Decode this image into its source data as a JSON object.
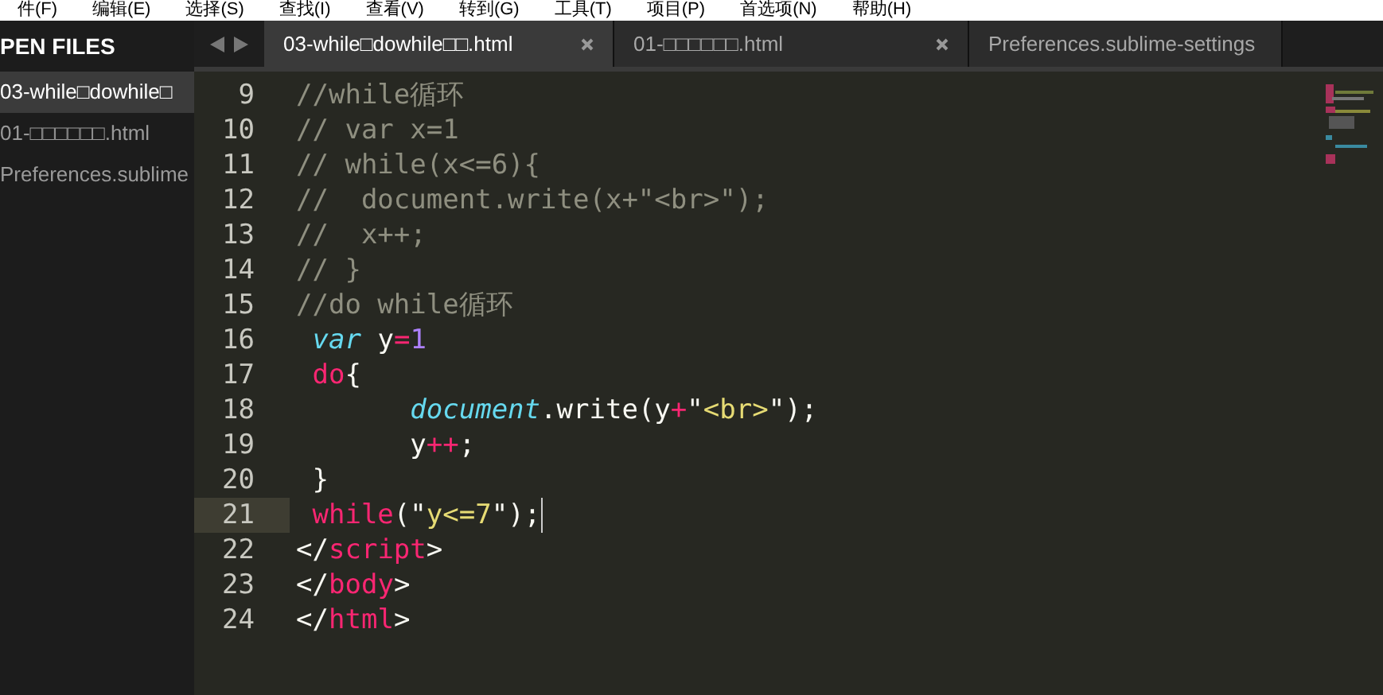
{
  "menu_bar": [
    "件(F)",
    "编辑(E)",
    "选择(S)",
    "查找(I)",
    "查看(V)",
    "转到(G)",
    "工具(T)",
    "项目(P)",
    "首选项(N)",
    "帮助(H)"
  ],
  "sidebar": {
    "title": "PEN FILES",
    "items": [
      {
        "label": "03-while□dowhile□",
        "selected": true
      },
      {
        "label": "01-□□□□□□.html",
        "selected": false
      },
      {
        "label": "Preferences.sublime",
        "selected": false
      }
    ]
  },
  "tabs": [
    {
      "label": "03-while□dowhile□□.html",
      "selected": true
    },
    {
      "label": "01-□□□□□□.html",
      "selected": false
    },
    {
      "label": "Preferences.sublime-settings",
      "selected": false
    }
  ],
  "editor": {
    "lines": [
      {
        "number": "9",
        "current": false,
        "tokens": [
          {
            "kind": "comment",
            "text": "//while循环"
          }
        ]
      },
      {
        "number": "10",
        "current": false,
        "tokens": [
          {
            "kind": "comment",
            "text": "// var x=1"
          }
        ]
      },
      {
        "number": "11",
        "current": false,
        "tokens": [
          {
            "kind": "comment",
            "text": "// while(x<=6){"
          }
        ]
      },
      {
        "number": "12",
        "current": false,
        "tokens": [
          {
            "kind": "comment",
            "text": "//  document.write(x+\"<br>\");"
          }
        ]
      },
      {
        "number": "13",
        "current": false,
        "tokens": [
          {
            "kind": "comment",
            "text": "//  x++;"
          }
        ]
      },
      {
        "number": "14",
        "current": false,
        "tokens": [
          {
            "kind": "comment",
            "text": "// }"
          }
        ]
      },
      {
        "number": "15",
        "current": false,
        "tokens": [
          {
            "kind": "comment",
            "text": "//do while循环"
          }
        ]
      },
      {
        "number": "16",
        "current": false,
        "tokens": [
          {
            "kind": "storage",
            "text": " var"
          },
          {
            "kind": "plain",
            "text": " y"
          },
          {
            "kind": "operator",
            "text": "="
          },
          {
            "kind": "number",
            "text": "1"
          }
        ]
      },
      {
        "number": "17",
        "current": false,
        "tokens": [
          {
            "kind": "keyword",
            "text": " do"
          },
          {
            "kind": "plain",
            "text": "{"
          }
        ]
      },
      {
        "number": "18",
        "current": false,
        "tokens": [
          {
            "kind": "storage",
            "text": "       document"
          },
          {
            "kind": "plain",
            "text": ".write(y"
          },
          {
            "kind": "operator",
            "text": "+"
          },
          {
            "kind": "plain",
            "text": "\""
          },
          {
            "kind": "string",
            "text": "<br>"
          },
          {
            "kind": "plain",
            "text": "\");"
          }
        ]
      },
      {
        "number": "19",
        "current": false,
        "tokens": [
          {
            "kind": "plain",
            "text": "       y"
          },
          {
            "kind": "operator",
            "text": "++"
          },
          {
            "kind": "plain",
            "text": ";"
          }
        ]
      },
      {
        "number": "20",
        "current": false,
        "tokens": [
          {
            "kind": "plain",
            "text": " }"
          }
        ]
      },
      {
        "number": "21",
        "current": true,
        "tokens": [
          {
            "kind": "keyword",
            "text": " while"
          },
          {
            "kind": "plain",
            "text": "(\""
          },
          {
            "kind": "string",
            "text": "y<=7"
          },
          {
            "kind": "plain",
            "text": "\");"
          }
        ]
      },
      {
        "number": "22",
        "current": false,
        "tokens": [
          {
            "kind": "plain",
            "text": "</"
          },
          {
            "kind": "keyword",
            "text": "script"
          },
          {
            "kind": "plain",
            "text": ">"
          }
        ]
      },
      {
        "number": "23",
        "current": false,
        "tokens": [
          {
            "kind": "plain",
            "text": "</"
          },
          {
            "kind": "keyword",
            "text": "body"
          },
          {
            "kind": "plain",
            "text": ">"
          }
        ]
      },
      {
        "number": "24",
        "current": false,
        "tokens": [
          {
            "kind": "plain",
            "text": "</"
          },
          {
            "kind": "keyword",
            "text": "html"
          },
          {
            "kind": "plain",
            "text": ">"
          }
        ]
      }
    ]
  }
}
